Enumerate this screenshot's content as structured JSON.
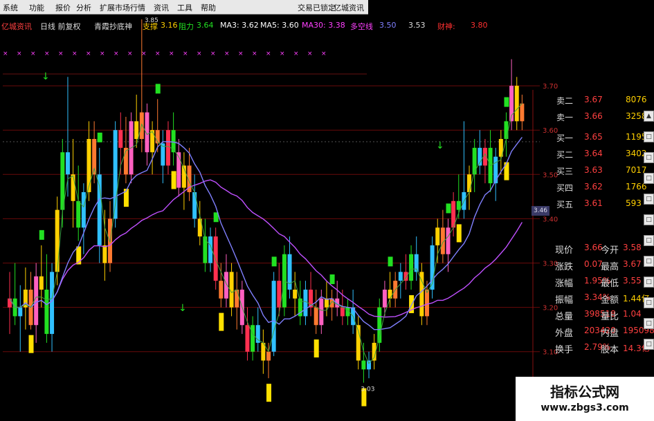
{
  "menu": {
    "items": [
      "系统",
      "功能",
      "报价",
      "分析",
      "扩展市场行情",
      "资讯",
      "工具",
      "帮助"
    ],
    "right_items": [
      "交易已锁定",
      "亿城资讯"
    ]
  },
  "info": {
    "app_title": "亿城资讯",
    "mode": "日线 前复权",
    "indicator_name": "青霞抄底神",
    "support_label": "支撑",
    "support_value": "3.16",
    "resistance_label": "阻力",
    "resistance_value": "3.64",
    "ma3": "MA3: 3.62",
    "ma5": "MA5: 3.60",
    "ma30": "MA30: 3.38",
    "dkx_label": "多空线",
    "dkx_value": "3.50",
    "extra_value": "3.53",
    "target_label": "财神:",
    "target_value": "3.80",
    "colors": {
      "support": "#ffd000",
      "resistance": "#22e022",
      "ma3": "#ffffff",
      "ma30": "#ff40ff"
    }
  },
  "chart_data": {
    "type": "candlestick",
    "y_ticks": [
      "3.70",
      "3.60",
      "3.50",
      "3.40",
      "3.30",
      "3.20",
      "3.10"
    ],
    "ylim": [
      3.02,
      3.8
    ],
    "last_price_tag": "3.46",
    "high_label": "3.85",
    "low_label": "3.03",
    "series": [
      {
        "name": "MA30",
        "color": "#c050ff"
      },
      {
        "name": "DKX",
        "color": "#8080ff"
      }
    ],
    "candles": [
      [
        3.2,
        3.28,
        3.14,
        3.22
      ],
      [
        3.22,
        3.3,
        3.16,
        3.18
      ],
      [
        3.18,
        3.25,
        3.1,
        3.2
      ],
      [
        3.2,
        3.29,
        3.15,
        3.24
      ],
      [
        3.24,
        3.28,
        3.15,
        3.16
      ],
      [
        3.16,
        3.3,
        3.12,
        3.27
      ],
      [
        3.27,
        3.34,
        3.2,
        3.24
      ],
      [
        3.24,
        3.32,
        3.12,
        3.14
      ],
      [
        3.14,
        3.3,
        3.1,
        3.28
      ],
      [
        3.28,
        3.45,
        3.25,
        3.42
      ],
      [
        3.42,
        3.58,
        3.38,
        3.55
      ],
      [
        3.55,
        3.72,
        3.45,
        3.5
      ],
      [
        3.5,
        3.58,
        3.38,
        3.44
      ],
      [
        3.44,
        3.52,
        3.35,
        3.38
      ],
      [
        3.38,
        3.48,
        3.32,
        3.46
      ],
      [
        3.46,
        3.62,
        3.44,
        3.58
      ],
      [
        3.58,
        3.62,
        3.48,
        3.5
      ],
      [
        3.5,
        3.56,
        3.3,
        3.34
      ],
      [
        3.34,
        3.42,
        3.26,
        3.3
      ],
      [
        3.3,
        3.44,
        3.28,
        3.4
      ],
      [
        3.4,
        3.62,
        3.38,
        3.6
      ],
      [
        3.6,
        3.64,
        3.5,
        3.56
      ],
      [
        3.56,
        3.63,
        3.48,
        3.5
      ],
      [
        3.5,
        3.64,
        3.48,
        3.62
      ],
      [
        3.62,
        3.68,
        3.56,
        3.58
      ],
      [
        3.58,
        3.85,
        3.55,
        3.64
      ],
      [
        3.64,
        3.66,
        3.52,
        3.55
      ],
      [
        3.55,
        3.62,
        3.5,
        3.6
      ],
      [
        3.6,
        3.67,
        3.55,
        3.57
      ],
      [
        3.57,
        3.6,
        3.48,
        3.52
      ],
      [
        3.52,
        3.62,
        3.5,
        3.6
      ],
      [
        3.6,
        3.64,
        3.52,
        3.55
      ],
      [
        3.55,
        3.58,
        3.45,
        3.47
      ],
      [
        3.47,
        3.55,
        3.42,
        3.52
      ],
      [
        3.52,
        3.56,
        3.44,
        3.46
      ],
      [
        3.46,
        3.5,
        3.38,
        3.4
      ],
      [
        3.4,
        3.44,
        3.34,
        3.36
      ],
      [
        3.36,
        3.4,
        3.28,
        3.3
      ],
      [
        3.3,
        3.38,
        3.28,
        3.36
      ],
      [
        3.36,
        3.38,
        3.24,
        3.26
      ],
      [
        3.26,
        3.3,
        3.2,
        3.22
      ],
      [
        3.22,
        3.32,
        3.2,
        3.28
      ],
      [
        3.28,
        3.3,
        3.18,
        3.2
      ],
      [
        3.2,
        3.28,
        3.15,
        3.24
      ],
      [
        3.24,
        3.26,
        3.14,
        3.16
      ],
      [
        3.16,
        3.2,
        3.08,
        3.1
      ],
      [
        3.1,
        3.18,
        3.08,
        3.16
      ],
      [
        3.16,
        3.2,
        3.1,
        3.12
      ],
      [
        3.12,
        3.15,
        3.05,
        3.08
      ],
      [
        3.08,
        3.12,
        3.04,
        3.1
      ],
      [
        3.1,
        3.28,
        3.09,
        3.26
      ],
      [
        3.26,
        3.3,
        3.18,
        3.2
      ],
      [
        3.2,
        3.34,
        3.18,
        3.32
      ],
      [
        3.32,
        3.36,
        3.22,
        3.24
      ],
      [
        3.24,
        3.28,
        3.18,
        3.22
      ],
      [
        3.22,
        3.26,
        3.16,
        3.18
      ],
      [
        3.18,
        3.26,
        3.16,
        3.24
      ],
      [
        3.24,
        3.28,
        3.18,
        3.2
      ],
      [
        3.2,
        3.24,
        3.14,
        3.16
      ],
      [
        3.16,
        3.24,
        3.14,
        3.22
      ],
      [
        3.22,
        3.26,
        3.18,
        3.2
      ],
      [
        3.2,
        3.24,
        3.17,
        3.22
      ],
      [
        3.22,
        3.26,
        3.18,
        3.2
      ],
      [
        3.2,
        3.24,
        3.16,
        3.18
      ],
      [
        3.18,
        3.22,
        3.16,
        3.2
      ],
      [
        3.2,
        3.24,
        3.14,
        3.16
      ],
      [
        3.16,
        3.18,
        3.06,
        3.08
      ],
      [
        3.08,
        3.12,
        3.03,
        3.06
      ],
      [
        3.06,
        3.1,
        3.04,
        3.08
      ],
      [
        3.08,
        3.14,
        3.06,
        3.12
      ],
      [
        3.12,
        3.22,
        3.1,
        3.2
      ],
      [
        3.2,
        3.26,
        3.18,
        3.24
      ],
      [
        3.24,
        3.28,
        3.2,
        3.22
      ],
      [
        3.22,
        3.28,
        3.2,
        3.26
      ],
      [
        3.26,
        3.3,
        3.22,
        3.28
      ],
      [
        3.28,
        3.32,
        3.24,
        3.26
      ],
      [
        3.26,
        3.34,
        3.24,
        3.32
      ],
      [
        3.32,
        3.36,
        3.26,
        3.28
      ],
      [
        3.28,
        3.3,
        3.16,
        3.18
      ],
      [
        3.18,
        3.26,
        3.16,
        3.24
      ],
      [
        3.24,
        3.36,
        3.22,
        3.34
      ],
      [
        3.34,
        3.4,
        3.3,
        3.38
      ],
      [
        3.38,
        3.42,
        3.3,
        3.32
      ],
      [
        3.32,
        3.4,
        3.28,
        3.38
      ],
      [
        3.38,
        3.46,
        3.36,
        3.44
      ],
      [
        3.44,
        3.5,
        3.4,
        3.42
      ],
      [
        3.42,
        3.62,
        3.4,
        3.46
      ],
      [
        3.46,
        3.52,
        3.42,
        3.5
      ],
      [
        3.5,
        3.58,
        3.46,
        3.56
      ],
      [
        3.56,
        3.6,
        3.5,
        3.52
      ],
      [
        3.52,
        3.58,
        3.48,
        3.56
      ],
      [
        3.56,
        3.6,
        3.46,
        3.48
      ],
      [
        3.48,
        3.56,
        3.44,
        3.54
      ],
      [
        3.54,
        3.6,
        3.5,
        3.58
      ],
      [
        3.58,
        3.64,
        3.54,
        3.62
      ],
      [
        3.62,
        3.76,
        3.6,
        3.7
      ],
      [
        3.7,
        3.72,
        3.6,
        3.62
      ],
      [
        3.62,
        3.68,
        3.6,
        3.66
      ]
    ]
  },
  "quote": {
    "rows": [
      {
        "label": "卖二",
        "value": "3.67",
        "volume": "8076"
      },
      {
        "label": "卖一",
        "value": "3.66",
        "volume": "3258"
      },
      {
        "label": "买一",
        "value": "3.65",
        "volume": "1195"
      },
      {
        "label": "买二",
        "value": "3.64",
        "volume": "3402"
      },
      {
        "label": "买三",
        "value": "3.63",
        "volume": "7017"
      },
      {
        "label": "买四",
        "value": "3.62",
        "volume": "1766"
      },
      {
        "label": "买五",
        "value": "3.61",
        "volume": "593"
      }
    ],
    "stats": [
      {
        "label": "现价",
        "value": "3.66",
        "label2": "今开",
        "value2": "3.58"
      },
      {
        "label": "涨跌",
        "value": "0.07",
        "label2": "最高",
        "value2": "3.67"
      },
      {
        "label": "涨幅",
        "value": "1.95%",
        "label2": "最低",
        "value2": "3.55"
      },
      {
        "label": "振幅",
        "value": "3.34%",
        "label2": "金额",
        "value2": "1.44亿"
      },
      {
        "label": "总量",
        "value": "398518",
        "label2": "量比",
        "value2": "1.04"
      },
      {
        "label": "外盘",
        "value": "203420",
        "label2": "内盘",
        "value2": "195098"
      },
      {
        "label": "换手",
        "value": "2.79%",
        "label2": "股本",
        "value2": "14.3亿"
      }
    ]
  },
  "watermark": {
    "line1": "指标公式网",
    "line2": "www.zbgs3.com"
  }
}
